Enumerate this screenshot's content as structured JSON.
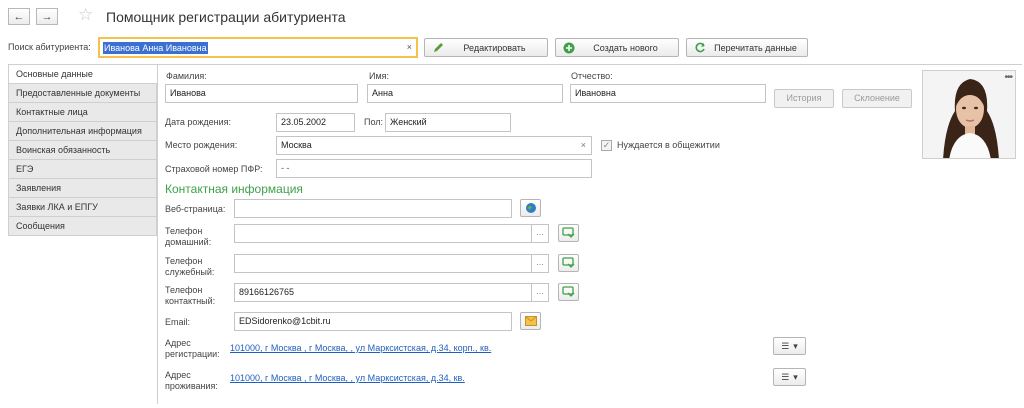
{
  "header": {
    "title": "Помощник регистрации абитуриента",
    "back_icon": "arrow-left-icon",
    "forward_icon": "arrow-right-icon",
    "star_icon": "star-icon"
  },
  "search": {
    "label": "Поиск абитуриента:",
    "value": "Иванова Анна Ивановна",
    "clear": "×"
  },
  "toolbar": {
    "edit_label": "Редактировать",
    "create_label": "Создать нового",
    "reread_label": "Перечитать данные"
  },
  "tabs": [
    {
      "label": "Основные данные"
    },
    {
      "label": "Предоставленные документы"
    },
    {
      "label": "Контактные лица"
    },
    {
      "label": "Дополнительная информация"
    },
    {
      "label": "Воинская обязанность"
    },
    {
      "label": "ЕГЭ"
    },
    {
      "label": "Заявления"
    },
    {
      "label": "Заявки ЛКА и ЕПГУ"
    },
    {
      "label": "Сообщения"
    }
  ],
  "person": {
    "last_name_label": "Фамилия:",
    "last_name": "Иванова",
    "first_name_label": "Имя:",
    "first_name": "Анна",
    "patronymic_label": "Отчество:",
    "patronymic": "Ивановна",
    "history_label": "История",
    "declension_label": "Склонение",
    "birth_date_label": "Дата рождения:",
    "birth_date": "23.05.2002",
    "gender_label": "Пол:",
    "gender": "Женский",
    "birth_place_label": "Место рождения:",
    "birth_place": "Москва",
    "birth_place_clear": "×",
    "dormitory_label": "Нуждается в общежитии",
    "dormitory_checked": true,
    "pfr_label": "Страховой номер ПФР:",
    "pfr_value": "-   -"
  },
  "contacts": {
    "section_title": "Контактная информация",
    "web_label": "Веб-страница:",
    "web_value": "",
    "phone_home_label1": "Телефон",
    "phone_home_label2": "домашний:",
    "phone_home_value": "",
    "phone_work_label1": "Телефон",
    "phone_work_label2": "служебный:",
    "phone_work_value": "",
    "phone_contact_label1": "Телефон",
    "phone_contact_label2": "контактный:",
    "phone_contact_value": "89166126765",
    "email_label": "Email:",
    "email_value": "EDSidorenko@1cbit.ru",
    "dots": "...",
    "reg_addr_label1": "Адрес",
    "reg_addr_label2": "регистрации:",
    "reg_addr_value": "101000, г Москва , г Москва, , ул Марксистская, д.34, корп., кв.",
    "live_addr_label1": "Адрес",
    "live_addr_label2": "проживания:",
    "live_addr_value": "101000, г Москва , г Москва, , ул Марксистская, д.34, кв."
  },
  "photo": {
    "menu": "•••"
  },
  "colors": {
    "accent_green": "#3fa04a",
    "search_border": "#f5c24a",
    "link_blue": "#1f5fbf"
  }
}
